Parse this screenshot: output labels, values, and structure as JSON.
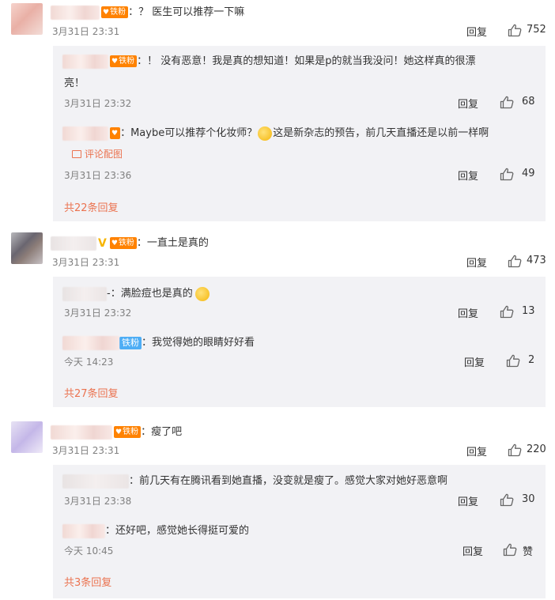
{
  "comments": [
    {
      "text": "：？ 医生可以推荐一下嘛",
      "badge": "铁粉",
      "time": "3月31日 23:31",
      "reply": "回复",
      "likes": "752",
      "replies": [
        {
          "text": "：！ 没有恶意！我是真的想知道！如果是p的就当我没问！她这样真的很漂",
          "text_cont": "亮！",
          "badge": "铁粉",
          "time": "3月31日 23:32",
          "reply": "回复",
          "likes": "68"
        },
        {
          "text_a": "：Maybe可以推荐个化妆师？",
          "text_b": "这是新杂志的预告，前几天直播还是以前一样啊",
          "pic_link": "评论配图",
          "time": "3月31日 23:36",
          "reply": "回复",
          "likes": "49"
        }
      ],
      "more": "共22条回复"
    },
    {
      "text": "：一直土是真的",
      "badge": "铁粉",
      "time": "3月31日 23:31",
      "reply": "回复",
      "likes": "473",
      "replies": [
        {
          "text": "-：满脸痘也是真的",
          "time": "3月31日 23:32",
          "reply": "回复",
          "likes": "13"
        },
        {
          "text": "：我觉得她的眼睛好好看",
          "badge": "铁粉",
          "time": "今天 14:23",
          "reply": "回复",
          "likes": "2"
        }
      ],
      "more": "共27条回复"
    },
    {
      "text": "：瘦了吧",
      "badge": "铁粉",
      "time": "3月31日 23:31",
      "reply": "回复",
      "likes": "220",
      "replies": [
        {
          "text": "：前几天有在腾讯看到她直播，没变就是瘦了。感觉大家对她好恶意啊",
          "time": "3月31日 23:38",
          "reply": "回复",
          "likes": "30"
        },
        {
          "text": "：还好吧，感觉她长得挺可爱的",
          "time": "今天 10:45",
          "reply": "回复",
          "likes": "赞"
        }
      ],
      "more": "共3条回复"
    }
  ],
  "colors": {
    "accent": "#eb7350",
    "badge": "#ff8200",
    "badge_blue": "#4dadf5",
    "sub_bg": "#f2f2f5",
    "meta": "#808080"
  },
  "icons": {
    "like": "thumbs-up-icon",
    "picture": "picture-icon",
    "vip": "v-verified-icon",
    "emoji": "emoji-icon"
  }
}
